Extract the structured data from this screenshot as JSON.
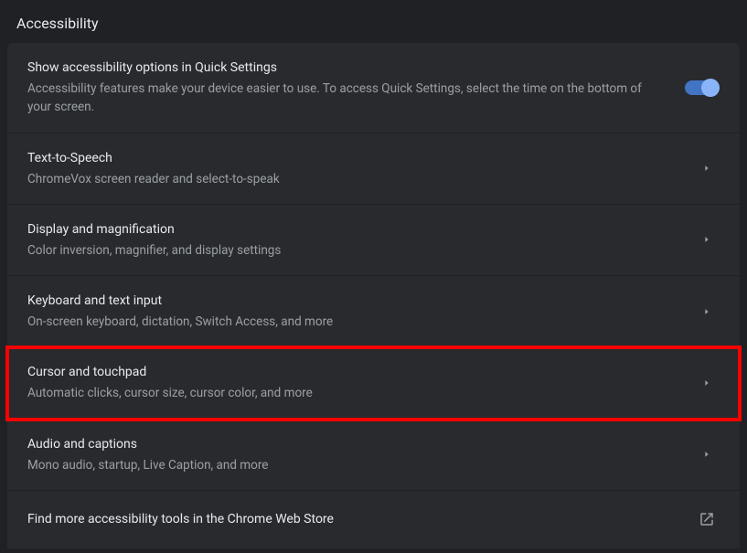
{
  "page_title": "Accessibility",
  "rows": {
    "quick_settings": {
      "title": "Show accessibility options in Quick Settings",
      "subtitle": "Accessibility features make your device easier to use. To access Quick Settings, select the time on the bottom of your screen.",
      "toggle_state": "on"
    },
    "tts": {
      "title": "Text-to-Speech",
      "subtitle": "ChromeVox screen reader and select-to-speak"
    },
    "display": {
      "title": "Display and magnification",
      "subtitle": "Color inversion, magnifier, and display settings"
    },
    "keyboard": {
      "title": "Keyboard and text input",
      "subtitle": "On-screen keyboard, dictation, Switch Access, and more"
    },
    "cursor": {
      "title": "Cursor and touchpad",
      "subtitle": "Automatic clicks, cursor size, cursor color, and more"
    },
    "audio": {
      "title": "Audio and captions",
      "subtitle": "Mono audio, startup, Live Caption, and more"
    },
    "webstore": {
      "title": "Find more accessibility tools in the Chrome Web Store"
    }
  }
}
